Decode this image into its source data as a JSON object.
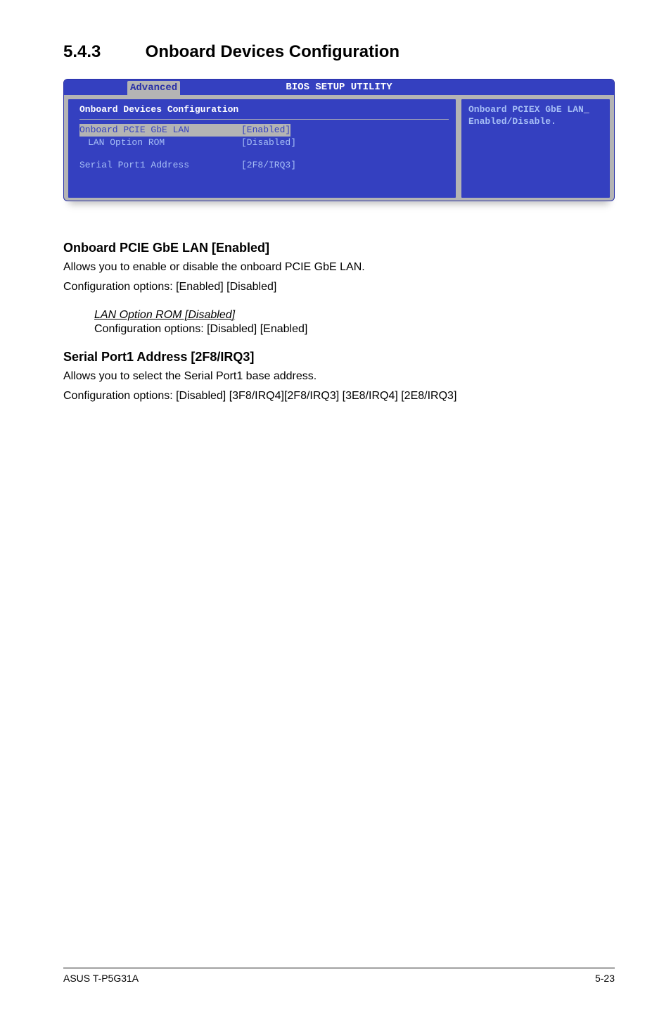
{
  "heading": {
    "number": "5.4.3",
    "title": "Onboard Devices Configuration"
  },
  "bios": {
    "header_title": "BIOS SETUP UTILITY",
    "tab": "Advanced",
    "section_title": "Onboard Devices Configuration",
    "rows": {
      "r1_label": "Onboard PCIE GbE LAN",
      "r1_value": "[Enabled]",
      "r2_label": "LAN Option ROM",
      "r2_value": "[Disabled]",
      "r3_label": "Serial Port1 Address",
      "r3_value": "[2F8/IRQ3]"
    },
    "help_line1": "Onboard PCIEX GbE LAN",
    "help_line2": "Enabled/Disable.",
    "cursor": "_"
  },
  "s1": {
    "heading": "Onboard PCIE GbE LAN [Enabled]",
    "line1": "Allows you to enable or disable the onboard PCIE GbE LAN.",
    "line2": "Configuration options: [Enabled] [Disabled]"
  },
  "s1sub": {
    "title": "LAN Option ROM [Disabled]",
    "line": "Configuration options: [Disabled] [Enabled]"
  },
  "s2": {
    "heading": "Serial Port1 Address [2F8/IRQ3]",
    "line1": "Allows you to select the Serial Port1 base address.",
    "line2": "Configuration options: [Disabled] [3F8/IRQ4][2F8/IRQ3] [3E8/IRQ4] [2E8/IRQ3]"
  },
  "footer": {
    "left": "ASUS T-P5G31A",
    "right": "5-23"
  }
}
